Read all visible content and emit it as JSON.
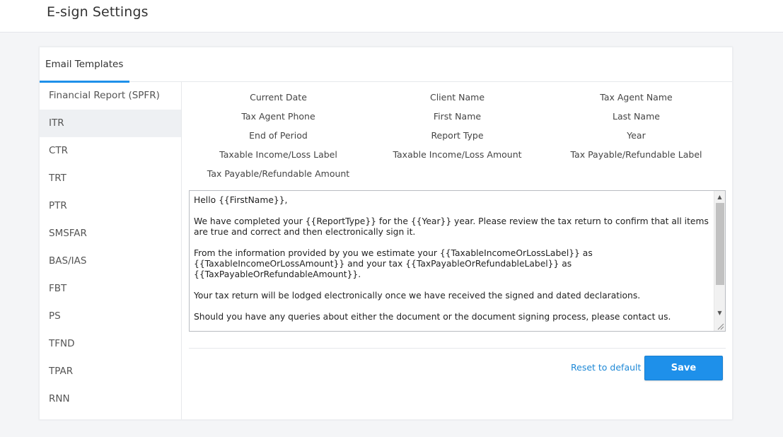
{
  "header": {
    "title": "E-sign Settings"
  },
  "tabs": [
    {
      "label": "Email Templates",
      "active": true
    }
  ],
  "sidebar": {
    "items": [
      {
        "label": "Financial Report (SPFR)"
      },
      {
        "label": "ITR",
        "active": true
      },
      {
        "label": "CTR"
      },
      {
        "label": "TRT"
      },
      {
        "label": "PTR"
      },
      {
        "label": "SMSFAR"
      },
      {
        "label": "BAS/IAS"
      },
      {
        "label": "FBT"
      },
      {
        "label": "PS"
      },
      {
        "label": "TFND"
      },
      {
        "label": "TPAR"
      },
      {
        "label": "RNN"
      }
    ]
  },
  "placeholders": [
    "Current Date",
    "Client Name",
    "Tax Agent Name",
    "Tax Agent Phone",
    "First Name",
    "Last Name",
    "End of Period",
    "Report Type",
    "Year",
    "Taxable Income/Loss Label",
    "Taxable Income/Loss Amount",
    "Tax Payable/Refundable Label",
    "Tax Payable/Refundable Amount"
  ],
  "editor": {
    "body": "Hello {{FirstName}},\n\nWe have completed your {{ReportType}} for the {{Year}} year. Please review the tax return to confirm that all items are true and correct and then electronically sign it.\n\nFrom the information provided by you we estimate your {{TaxableIncomeOrLossLabel}} as {{TaxableIncomeOrLossAmount}} and your tax {{TaxPayableOrRefundableLabel}} as {{TaxPayableOrRefundableAmount}}.\n\nYour tax return will be lodged electronically once we have received the signed and dated declarations.\n\nShould you have any queries about either the document or the document signing process, please contact us."
  },
  "actions": {
    "reset_label": "Reset to default",
    "save_label": "Save"
  },
  "colors": {
    "accent": "#1e90ea",
    "link": "#1e88d6",
    "active_bg": "#eef0f3"
  }
}
